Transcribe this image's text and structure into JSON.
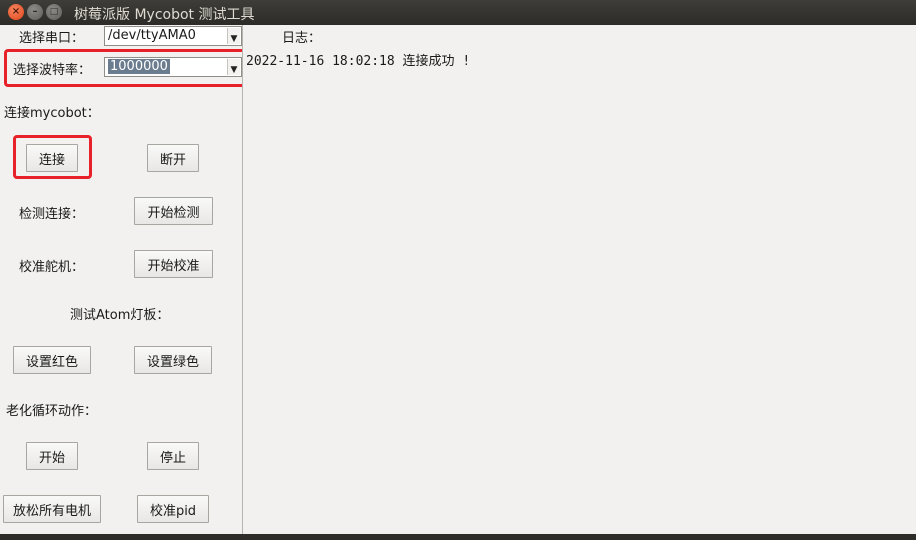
{
  "window": {
    "title": "树莓派版 Mycobot 测试工具",
    "close_glyph": "×",
    "min_glyph": "–",
    "max_glyph": "□"
  },
  "serial": {
    "label": "选择串口：",
    "value": "/dev/ttyAMA0",
    "dropdown_icon": "chevron-down-icon"
  },
  "baud": {
    "label": "选择波特率：",
    "value": "1000000"
  },
  "connect_section": {
    "label": "连接mycobot：",
    "connect_button": "连接",
    "disconnect_button": "断开"
  },
  "check_section": {
    "label": "检测连接：",
    "button": "开始检测"
  },
  "calibrate_section": {
    "label": "校准舵机：",
    "button": "开始校准"
  },
  "atom_section": {
    "label": "测试Atom灯板：",
    "red_button": "设置红色",
    "green_button": "设置绿色"
  },
  "aging_section": {
    "label": "老化循环动作：",
    "start_button": "开始",
    "stop_button": "停止"
  },
  "bottom_buttons": {
    "release_motors": "放松所有电机",
    "calibrate_pid": "校准pid"
  },
  "log": {
    "label": "日志：",
    "lines": [
      "2022-11-16 18:02:18 连接成功 !"
    ]
  },
  "colors": {
    "highlight_red": "#e8202a",
    "titlebar": "#2c2b28",
    "close_orange": "#e0471a"
  }
}
